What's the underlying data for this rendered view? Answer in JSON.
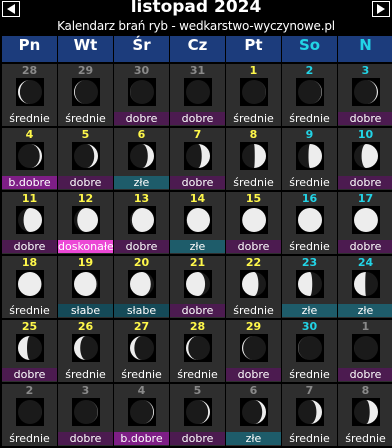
{
  "header": {
    "title": "listopad 2024",
    "subtitle": "Kalendarz brań ryb - wedkarstwo-wyczynowe.pl",
    "prev_icon": "triangle-left-icon",
    "next_icon": "triangle-right-icon"
  },
  "weekdays": [
    "Pn",
    "Wt",
    "Śr",
    "Cz",
    "Pt",
    "So",
    "N"
  ],
  "colors": {
    "header_bg": "#1c3c7c",
    "cell_bg": "#2e2e2e",
    "current_day_number": "#fff84a",
    "weekend": "#22d4e6",
    "outside_month": "#8a8a8a",
    "dobre": "#4c1b50",
    "b.dobre": "#7e1e86",
    "doskonałe": "#ec48d6",
    "złe": "#1e5c6a",
    "słabe": "#154a58",
    "średnie": "#2e2e2e"
  },
  "weeks": [
    [
      {
        "day": "28",
        "type": "out",
        "phase": 0.91,
        "rating": "średnie"
      },
      {
        "day": "29",
        "type": "out",
        "phase": 0.94,
        "rating": "średnie"
      },
      {
        "day": "30",
        "type": "out",
        "phase": 0.98,
        "rating": "dobre"
      },
      {
        "day": "31",
        "type": "out",
        "phase": 0.0,
        "rating": "dobre"
      },
      {
        "day": "1",
        "type": "cur",
        "phase": 0.02,
        "rating": "średnie"
      },
      {
        "day": "2",
        "type": "wk",
        "phase": 0.04,
        "rating": "średnie"
      },
      {
        "day": "3",
        "type": "wk",
        "phase": 0.07,
        "rating": "dobre"
      }
    ],
    [
      {
        "day": "4",
        "type": "cur",
        "phase": 0.1,
        "rating": "b.dobre"
      },
      {
        "day": "5",
        "type": "cur",
        "phase": 0.13,
        "rating": "dobre"
      },
      {
        "day": "6",
        "type": "cur",
        "phase": 0.17,
        "rating": "złe"
      },
      {
        "day": "7",
        "type": "cur",
        "phase": 0.2,
        "rating": "dobre"
      },
      {
        "day": "8",
        "type": "cur",
        "phase": 0.24,
        "rating": "średnie"
      },
      {
        "day": "9",
        "type": "wk",
        "phase": 0.27,
        "rating": "średnie"
      },
      {
        "day": "10",
        "type": "wk",
        "phase": 0.31,
        "rating": "dobre"
      }
    ],
    [
      {
        "day": "11",
        "type": "cur",
        "phase": 0.34,
        "rating": "dobre"
      },
      {
        "day": "12",
        "type": "cur",
        "phase": 0.38,
        "rating": "doskonałe"
      },
      {
        "day": "13",
        "type": "cur",
        "phase": 0.41,
        "rating": "dobre"
      },
      {
        "day": "14",
        "type": "cur",
        "phase": 0.44,
        "rating": "złe"
      },
      {
        "day": "15",
        "type": "cur",
        "phase": 0.47,
        "rating": "dobre"
      },
      {
        "day": "16",
        "type": "wk",
        "phase": 0.5,
        "rating": "średnie"
      },
      {
        "day": "17",
        "type": "wk",
        "phase": 0.52,
        "rating": "dobre"
      }
    ],
    [
      {
        "day": "18",
        "type": "cur",
        "phase": 0.55,
        "rating": "średnie"
      },
      {
        "day": "19",
        "type": "cur",
        "phase": 0.58,
        "rating": "słabe"
      },
      {
        "day": "20",
        "type": "cur",
        "phase": 0.62,
        "rating": "słabe"
      },
      {
        "day": "21",
        "type": "cur",
        "phase": 0.65,
        "rating": "dobre"
      },
      {
        "day": "22",
        "type": "cur",
        "phase": 0.69,
        "rating": "średnie"
      },
      {
        "day": "23",
        "type": "wk",
        "phase": 0.72,
        "rating": "złe"
      },
      {
        "day": "24",
        "type": "wk",
        "phase": 0.76,
        "rating": "złe"
      }
    ],
    [
      {
        "day": "25",
        "type": "cur",
        "phase": 0.79,
        "rating": "dobre"
      },
      {
        "day": "26",
        "type": "cur",
        "phase": 0.83,
        "rating": "średnie"
      },
      {
        "day": "27",
        "type": "cur",
        "phase": 0.86,
        "rating": "średnie"
      },
      {
        "day": "28",
        "type": "cur",
        "phase": 0.9,
        "rating": "średnie"
      },
      {
        "day": "29",
        "type": "cur",
        "phase": 0.93,
        "rating": "dobre"
      },
      {
        "day": "30",
        "type": "wk",
        "phase": 0.97,
        "rating": "średnie"
      },
      {
        "day": "1",
        "type": "out",
        "phase": 0.99,
        "rating": "dobre"
      }
    ],
    [
      {
        "day": "2",
        "type": "out",
        "phase": 0.01,
        "rating": "średnie"
      },
      {
        "day": "3",
        "type": "out",
        "phase": 0.03,
        "rating": "dobre"
      },
      {
        "day": "4",
        "type": "out",
        "phase": 0.06,
        "rating": "b.dobre"
      },
      {
        "day": "5",
        "type": "out",
        "phase": 0.09,
        "rating": "dobre"
      },
      {
        "day": "6",
        "type": "out",
        "phase": 0.13,
        "rating": "złe"
      },
      {
        "day": "7",
        "type": "out",
        "phase": 0.16,
        "rating": "średnie"
      },
      {
        "day": "8",
        "type": "out",
        "phase": 0.2,
        "rating": "średnie"
      }
    ]
  ]
}
